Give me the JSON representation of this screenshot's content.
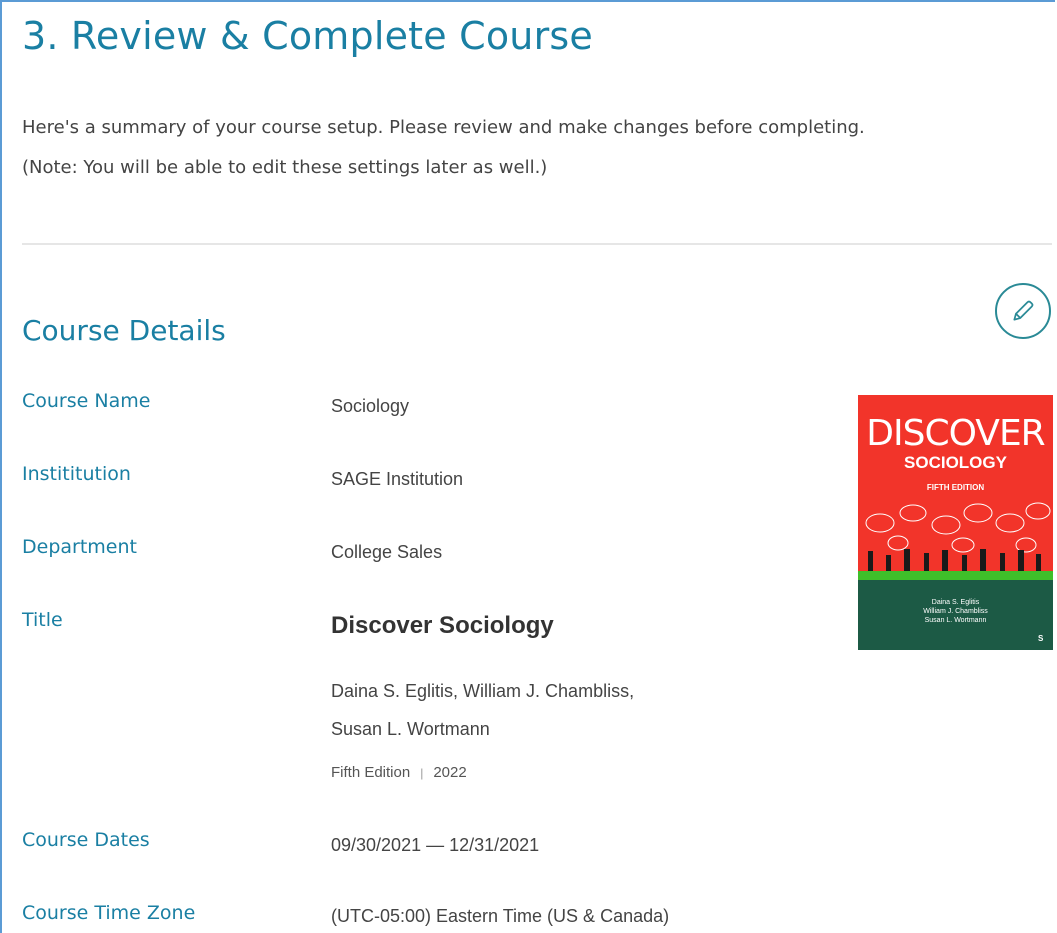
{
  "page": {
    "title": "3. Review & Complete Course",
    "summary_line1": "Here's a summary of your course setup. Please review and make changes before completing.",
    "summary_line2": "(Note: You will be able to edit these settings later as well.)"
  },
  "course_details": {
    "section_title": "Course Details",
    "edit_icon": "pencil-icon",
    "fields": {
      "course_name": {
        "label": "Course Name",
        "value": "Sociology"
      },
      "institution": {
        "label": "Instititution",
        "value": "SAGE Institution"
      },
      "department": {
        "label": "Department",
        "value": "College Sales"
      },
      "title": {
        "label": "Title",
        "book_title": "Discover Sociology",
        "authors_line1": "Daina S. Eglitis, William J. Chambliss,",
        "authors_line2": "Susan L. Wortmann",
        "edition": "Fifth Edition",
        "separator": "|",
        "year": "2022"
      },
      "course_dates": {
        "label": "Course Dates",
        "value": "09/30/2021 — 12/31/2021"
      },
      "time_zone": {
        "label": "Course Time Zone",
        "value": "(UTC-05:00) Eastern Time (US & Canada)"
      }
    }
  },
  "book_cover": {
    "word1": "DISCOVER",
    "word2": "SOCIOLOGY",
    "edition": "FIFTH EDITION",
    "author1": "Daina S. Eglitis",
    "author2": "William J. Chambliss",
    "author3": "Susan L. Wortmann",
    "publisher_mark": "S",
    "colors": {
      "top": "#f2342a",
      "band": "#3fbf2a",
      "bottom": "#1c5a45"
    }
  },
  "colors": {
    "accent": "#1a7fa3",
    "edit_border": "#2a8a96",
    "frame": "#5b9bd5"
  }
}
